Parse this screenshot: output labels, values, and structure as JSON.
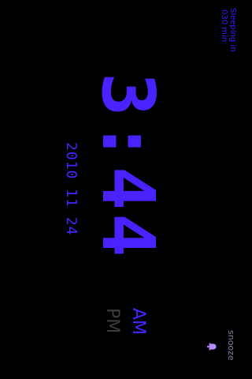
{
  "sleep": {
    "label": "Sleeping in",
    "value": "030 min"
  },
  "clock": {
    "time": "3:44",
    "am": "AM",
    "pm": "PM",
    "active_period": "AM",
    "date": "2010 11 24"
  },
  "snooze": {
    "label": "snooze",
    "icon": "bell-icon"
  },
  "colors": {
    "background": "#000000",
    "accent": "#4a22ff",
    "inactive": "#3c3c3c",
    "snooze_text": "#8a7a9a",
    "bell": "#b48cff"
  }
}
